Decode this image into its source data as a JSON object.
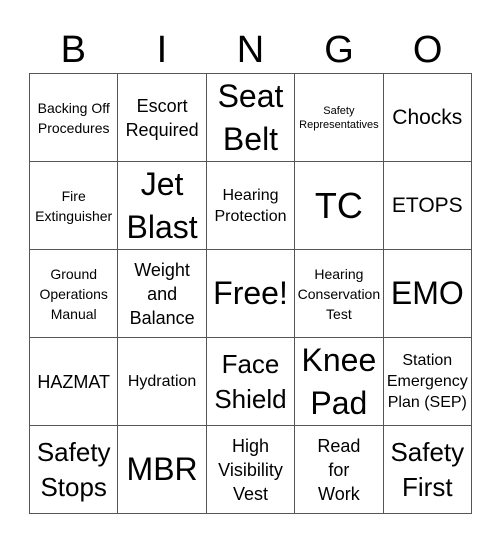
{
  "header": {
    "letters": [
      "B",
      "I",
      "N",
      "G",
      "O"
    ]
  },
  "card": {
    "rows": [
      [
        {
          "text": "Backing Off\nProcedures",
          "size": "fs-s"
        },
        {
          "text": "Escort\nRequired",
          "size": "fs-ml"
        },
        {
          "text": "Seat\nBelt",
          "size": "fs-xxl"
        },
        {
          "text": "Safety\nRepresentatives",
          "size": "fs-xs"
        },
        {
          "text": "Chocks",
          "size": "fs-l"
        }
      ],
      [
        {
          "text": "Fire\nExtinguisher",
          "size": "fs-s"
        },
        {
          "text": "Jet\nBlast",
          "size": "fs-xxl"
        },
        {
          "text": "Hearing\nProtection",
          "size": "fs-m"
        },
        {
          "text": "TC",
          "size": "fs-xxxl"
        },
        {
          "text": "ETOPS",
          "size": "fs-l"
        }
      ],
      [
        {
          "text": "Ground\nOperations\nManual",
          "size": "fs-s"
        },
        {
          "text": "Weight\nand\nBalance",
          "size": "fs-ml"
        },
        {
          "text": "Free!",
          "size": "fs-xxl"
        },
        {
          "text": "Hearing\nConservation\nTest",
          "size": "fs-s"
        },
        {
          "text": "EMO",
          "size": "fs-xxl"
        }
      ],
      [
        {
          "text": "HAZMAT",
          "size": "fs-ml"
        },
        {
          "text": "Hydration",
          "size": "fs-m"
        },
        {
          "text": "Face\nShield",
          "size": "fs-xl"
        },
        {
          "text": "Knee\nPad",
          "size": "fs-xxl"
        },
        {
          "text": "Station\nEmergency\nPlan (SEP)",
          "size": "fs-m"
        }
      ],
      [
        {
          "text": "Safety\nStops",
          "size": "fs-xl"
        },
        {
          "text": "MBR",
          "size": "fs-xxl"
        },
        {
          "text": "High\nVisibility\nVest",
          "size": "fs-ml"
        },
        {
          "text": "Read\nfor\nWork",
          "size": "fs-ml"
        },
        {
          "text": "Safety\nFirst",
          "size": "fs-xl"
        }
      ]
    ]
  }
}
